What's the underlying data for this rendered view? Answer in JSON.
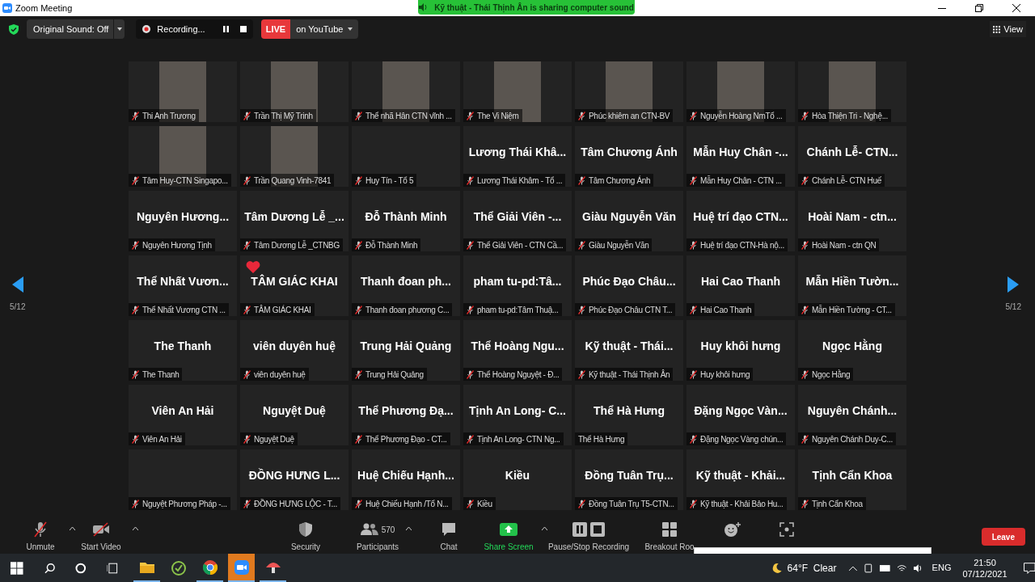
{
  "window": {
    "title": "Zoom Meeting"
  },
  "sharing_banner": "Kỹ thuật - Thái Thịnh Ân is sharing computer sound",
  "top_bar": {
    "original_sound": "Original Sound: Off",
    "recording": "Recording...",
    "live_badge": "LIVE",
    "live_target": "on YouTube",
    "view": "View"
  },
  "pager": {
    "left": "5/12",
    "right": "5/12"
  },
  "tiles": [
    {
      "kind": "video",
      "label": "Thi Anh Trương",
      "muted": true,
      "reaction": false
    },
    {
      "kind": "video",
      "label": "Trần Thị Mỹ Trinh",
      "muted": true,
      "reaction": false
    },
    {
      "kind": "video",
      "label": "Thể nhã Hân CTN vĩnh ...",
      "muted": true,
      "reaction": false
    },
    {
      "kind": "video",
      "label": "The Vi Niệm",
      "muted": true,
      "reaction": false
    },
    {
      "kind": "video",
      "label": "Phúc khiêm an CTN-BV",
      "muted": true,
      "reaction": false
    },
    {
      "kind": "video",
      "label": "Nguyễn Hoàng NmTổ ...",
      "muted": true,
      "reaction": false
    },
    {
      "kind": "video",
      "label": "Hòa Thiện Tri  -  Nghệ...",
      "muted": true,
      "reaction": false
    },
    {
      "kind": "video",
      "label": "Tâm Huy-CTN Singapo...",
      "muted": true,
      "reaction": false
    },
    {
      "kind": "video",
      "label": "Trần Quang Vinh-7841",
      "muted": true,
      "reaction": false
    },
    {
      "kind": "blank",
      "label": "Huy Tín - Tổ 5",
      "muted": true,
      "reaction": false
    },
    {
      "kind": "name",
      "name": "Lương Thái Khâ...",
      "label": "Lương Thái Khâm - Tổ ...",
      "muted": true,
      "reaction": false
    },
    {
      "kind": "name",
      "name": "Tâm Chương Ánh",
      "label": "Tâm Chương Ánh",
      "muted": true,
      "reaction": false
    },
    {
      "kind": "name",
      "name": "Mẫn Huy Chân -...",
      "label": "Mẫn Huy Chân - CTN ...",
      "muted": true,
      "reaction": false
    },
    {
      "kind": "name",
      "name": "Chánh Lễ- CTN...",
      "label": "Chánh Lễ- CTN Huế",
      "muted": true,
      "reaction": false
    },
    {
      "kind": "name",
      "name": "Nguyên Hương...",
      "label": "Nguyên Hương Tịnh",
      "muted": true,
      "reaction": false
    },
    {
      "kind": "name",
      "name": "Tâm Dương Lễ _...",
      "label": "Tâm Dương Lễ _CTNBG",
      "muted": true,
      "reaction": false
    },
    {
      "kind": "name",
      "name": "Đỗ Thành Minh",
      "label": "Đỗ Thành Minh",
      "muted": true,
      "reaction": false
    },
    {
      "kind": "name",
      "name": "Thể Giải Viên -...",
      "label": "Thể Giải Viên - CTN Cầ...",
      "muted": true,
      "reaction": false
    },
    {
      "kind": "name",
      "name": "Giàu Nguyễn Văn",
      "label": "Giàu Nguyễn Văn",
      "muted": true,
      "reaction": false
    },
    {
      "kind": "name",
      "name": "Huệ trí đạo CTN...",
      "label": "Huệ trí đạo CTN-Hà nộ...",
      "muted": true,
      "reaction": false
    },
    {
      "kind": "name",
      "name": "Hoài Nam - ctn...",
      "label": "Hoài Nam - ctn QN",
      "muted": true,
      "reaction": false
    },
    {
      "kind": "name",
      "name": "Thể Nhất Vươn...",
      "label": "Thể Nhất Vương CTN ...",
      "muted": true,
      "reaction": false
    },
    {
      "kind": "name",
      "name": "TÂM GIÁC KHAI",
      "label": "TÂM GIÁC KHAI",
      "muted": true,
      "reaction": true
    },
    {
      "kind": "name",
      "name": "Thanh đoan ph...",
      "label": "Thanh đoan phương C...",
      "muted": true,
      "reaction": false
    },
    {
      "kind": "name",
      "name": "pham tu-pd:Tâ...",
      "label": "pham tu-pd:Tâm Thuậ...",
      "muted": true,
      "reaction": false
    },
    {
      "kind": "name",
      "name": "Phúc Đạo Châu...",
      "label": "Phúc Đạo Châu CTN T...",
      "muted": true,
      "reaction": false
    },
    {
      "kind": "name",
      "name": "Hai Cao Thanh",
      "label": "Hai Cao Thanh",
      "muted": true,
      "reaction": false
    },
    {
      "kind": "name",
      "name": "Mẫn Hiền Tườn...",
      "label": "Mẫn Hiền Tường - CT...",
      "muted": true,
      "reaction": false
    },
    {
      "kind": "name",
      "name": "The Thanh",
      "label": "The Thanh",
      "muted": true,
      "reaction": false
    },
    {
      "kind": "name",
      "name": "viên duyên huệ",
      "label": "viên duyên huệ",
      "muted": true,
      "reaction": false
    },
    {
      "kind": "name",
      "name": "Trung Hải Quảng",
      "label": "Trung Hải Quảng",
      "muted": true,
      "reaction": false
    },
    {
      "kind": "name",
      "name": "Thể Hoàng Ngu...",
      "label": "Thể Hoàng Nguyệt - Đ...",
      "muted": true,
      "reaction": false
    },
    {
      "kind": "name",
      "name": "Kỹ thuật - Thái...",
      "label": "Kỹ thuật - Thái Thịnh Ân",
      "muted": true,
      "reaction": false
    },
    {
      "kind": "name",
      "name": "Huy khôi hưng",
      "label": "Huy khôi hưng",
      "muted": true,
      "reaction": false
    },
    {
      "kind": "name",
      "name": "Ngọc Hằng",
      "label": "Ngọc Hằng",
      "muted": true,
      "reaction": false
    },
    {
      "kind": "name",
      "name": "Viên An Hải",
      "label": "Viên An Hải",
      "muted": true,
      "reaction": false
    },
    {
      "kind": "name",
      "name": "Nguyệt Duệ",
      "label": "Nguyệt Duệ",
      "muted": true,
      "reaction": false
    },
    {
      "kind": "name",
      "name": "Thể Phương Đạ...",
      "label": "Thể Phương Đạo - CT...",
      "muted": true,
      "reaction": false
    },
    {
      "kind": "name",
      "name": "Tịnh An Long- C...",
      "label": "Tịnh An Long- CTN Ng...",
      "muted": true,
      "reaction": false
    },
    {
      "kind": "name",
      "name": "Thể Hà Hưng",
      "label": "Thể Hà Hưng",
      "muted": false,
      "reaction": false
    },
    {
      "kind": "name",
      "name": "Đặng Ngọc Vàn...",
      "label": "Đặng Ngọc Vàng chún...",
      "muted": true,
      "reaction": false
    },
    {
      "kind": "name",
      "name": "Nguyên Chánh...",
      "label": "Nguyên Chánh Duy-C...",
      "muted": true,
      "reaction": false
    },
    {
      "kind": "blank",
      "label": "Nguyệt Phương Pháp -...",
      "muted": true,
      "reaction": false
    },
    {
      "kind": "name",
      "name": "ĐỒNG HƯNG L...",
      "label": "ĐỒNG HƯNG LỘC - T...",
      "muted": true,
      "reaction": false
    },
    {
      "kind": "name",
      "name": "Huệ Chiếu Hạnh...",
      "label": "Huệ Chiếu Hạnh /Tổ N...",
      "muted": true,
      "reaction": false
    },
    {
      "kind": "name",
      "name": "Kiều",
      "label": "Kiều",
      "muted": true,
      "reaction": false
    },
    {
      "kind": "name",
      "name": "Đồng Tuân Trụ...",
      "label": "Đồng Tuân Trụ T5-CTN...",
      "muted": true,
      "reaction": false
    },
    {
      "kind": "name",
      "name": "Kỹ thuật - Khải...",
      "label": "Kỹ thuật - Khải Bảo Hu...",
      "muted": true,
      "reaction": false
    },
    {
      "kind": "name",
      "name": "Tịnh Cẩn Khoa",
      "label": "Tịnh Cẩn Khoa",
      "muted": true,
      "reaction": false
    }
  ],
  "toolbar": [
    {
      "kind": "mic",
      "label": "Unmute",
      "caret": true
    },
    {
      "kind": "video",
      "label": "Start Video",
      "caret": true
    },
    {
      "kind": "security",
      "label": "Security",
      "caret": false
    },
    {
      "kind": "participants",
      "label": "Participants",
      "count": "570",
      "caret": true
    },
    {
      "kind": "chat",
      "label": "Chat",
      "caret": false
    },
    {
      "kind": "share",
      "label": "Share Screen",
      "caret": true
    },
    {
      "kind": "record",
      "label": "Pause/Stop Recording",
      "caret": false
    },
    {
      "kind": "breakout",
      "label": "Breakout Roo",
      "caret": false
    },
    {
      "kind": "reactions",
      "caret": false
    },
    {
      "kind": "apps",
      "caret": false
    }
  ],
  "leave": "Leave",
  "taskbar": {
    "weather": "64°F  Clear",
    "language": "ENG",
    "time": "21:50",
    "date": "07/12/2021"
  }
}
